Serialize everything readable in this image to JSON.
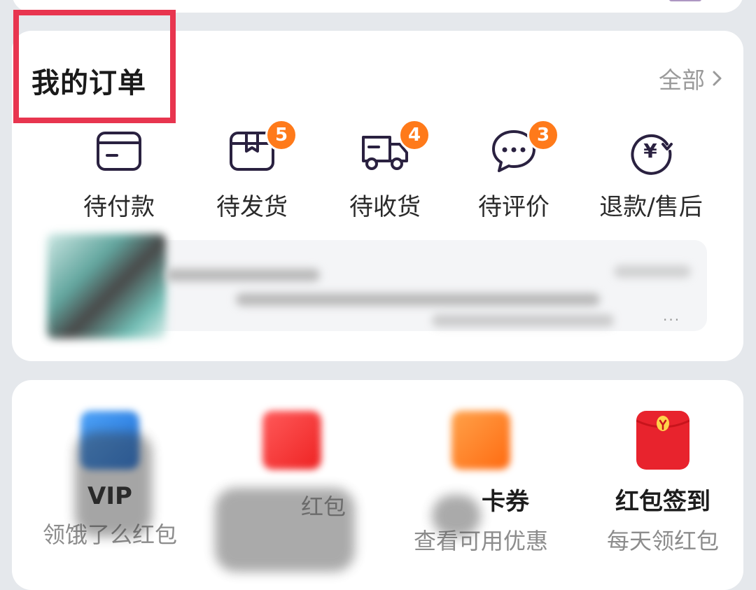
{
  "orders": {
    "title": "我的订单",
    "all_label": "全部",
    "items": [
      {
        "label": "待付款",
        "icon": "wallet-card-icon"
      },
      {
        "label": "待发货",
        "icon": "package-box-icon",
        "badge": "5"
      },
      {
        "label": "待收货",
        "icon": "delivery-truck-icon",
        "badge": "4"
      },
      {
        "label": "待评价",
        "icon": "chat-bubble-icon",
        "badge": "3"
      },
      {
        "label": "退款/售后",
        "icon": "yuan-refund-icon"
      }
    ],
    "package_more": "..."
  },
  "services": [
    {
      "title": "VIP",
      "sub": "领饿了么红包",
      "icon": "vip-icon"
    },
    {
      "title": "",
      "sub": "红包",
      "icon": "red-coupon-icon"
    },
    {
      "title": "卡券",
      "sub": "查看可用优惠",
      "icon": "coupon-card-icon"
    },
    {
      "title": "红包签到",
      "sub": "每天领红包",
      "icon": "red-envelope-icon"
    }
  ],
  "colors": {
    "accent_badge": "#ff7a1a",
    "highlight_box": "#e8354f",
    "icon_stroke": "#2a2140",
    "envelope_red": "#e8232d"
  }
}
